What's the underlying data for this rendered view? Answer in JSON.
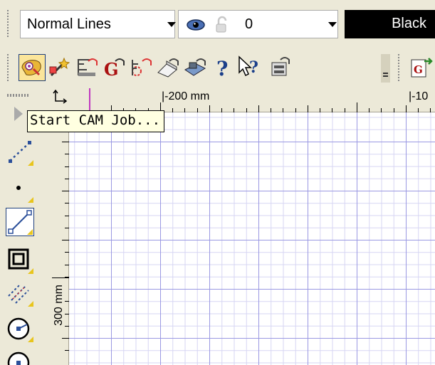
{
  "properties_bar": {
    "line_style_value": "Normal Lines",
    "layer_value": "0",
    "color_value": "Black",
    "icons": [
      "eye-icon",
      "lock-icon"
    ]
  },
  "main_toolbar": {
    "buttons": [
      "cam-wizard-icon",
      "magic-wand-icon",
      "toolpath-icon",
      "g-code-icon",
      "drill-pattern-icon",
      "eraser-pencil-icon",
      "tool-database-icon",
      "help-icon",
      "whats-this-icon",
      "machine-settings-icon",
      "overflow-chevron-icon",
      "g-code-export-icon"
    ]
  },
  "left_toolbar": {
    "buttons": [
      "line-dashes-icon",
      "point-icon",
      "line-tool-icon",
      "rectangle-icon",
      "hatch-lines-icon",
      "circle-center-icon",
      "circle-tool-icon"
    ]
  },
  "ruler": {
    "top_label_1": "|-200 mm",
    "top_label_2": "|-10",
    "left_label": "300 mm"
  },
  "tooltip": {
    "text": "Start CAM Job..."
  },
  "colors": {
    "toolbar_bg": "#ece9d8",
    "grid_major": "#9a98e2",
    "grid_minor": "#d6d5f3",
    "tooltip_bg": "#ffffe1",
    "color_swatch": "#000000"
  }
}
